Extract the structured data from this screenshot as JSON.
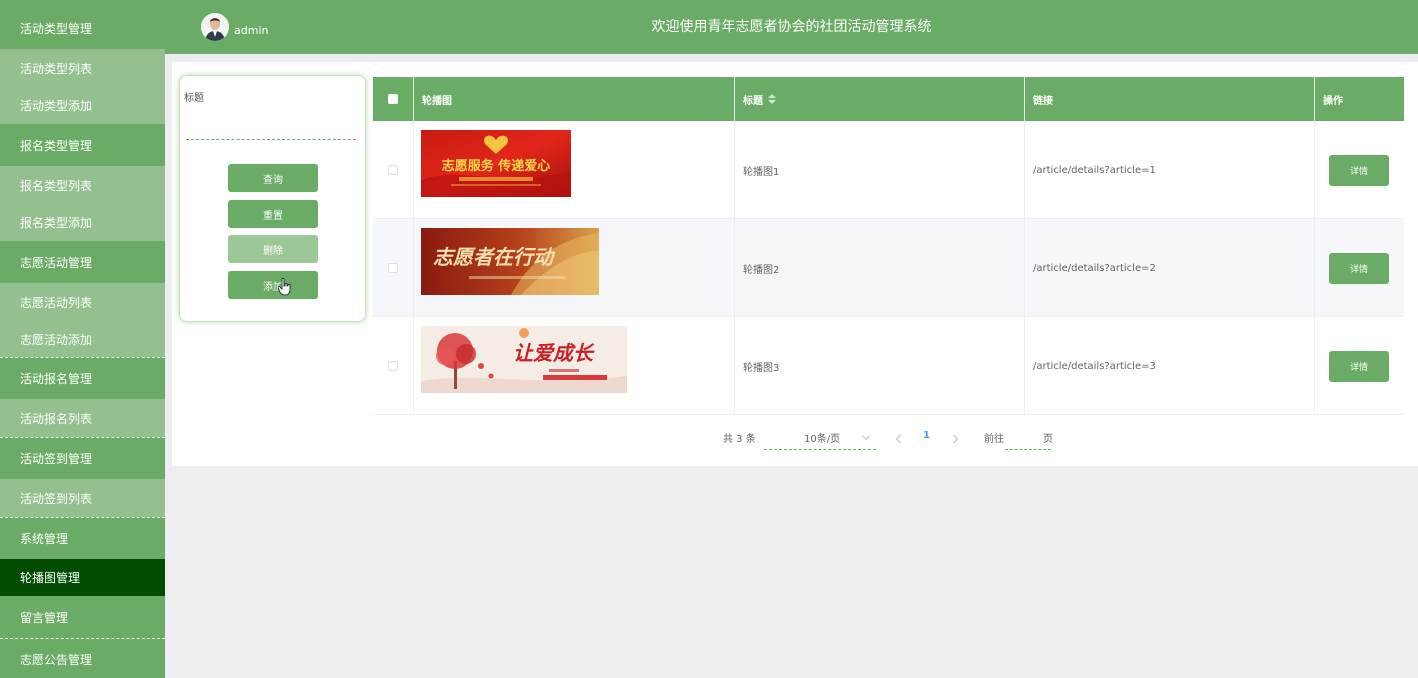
{
  "sidebar": {
    "items": [
      {
        "label": "活动类型管理",
        "kind": "group"
      },
      {
        "label": "活动类型列表",
        "kind": "sub"
      },
      {
        "label": "活动类型添加",
        "kind": "sub"
      },
      {
        "label": "报名类型管理",
        "kind": "group"
      },
      {
        "label": "报名类型列表",
        "kind": "sub"
      },
      {
        "label": "报名类型添加",
        "kind": "sub"
      },
      {
        "label": "志愿活动管理",
        "kind": "group"
      },
      {
        "label": "志愿活动列表",
        "kind": "sub"
      },
      {
        "label": "志愿活动添加",
        "kind": "sub"
      },
      {
        "label": "活动报名管理",
        "kind": "group"
      },
      {
        "label": "活动报名列表",
        "kind": "sub"
      },
      {
        "label": "活动签到管理",
        "kind": "group"
      },
      {
        "label": "活动签到列表",
        "kind": "sub"
      },
      {
        "label": "系统管理",
        "kind": "group"
      },
      {
        "label": "轮播图管理",
        "kind": "active"
      },
      {
        "label": "留言管理",
        "kind": "group"
      },
      {
        "label": "志愿公告管理",
        "kind": "group"
      }
    ]
  },
  "header": {
    "username": "admin",
    "title": "欢迎使用青年志愿者协会的社团活动管理系统"
  },
  "search": {
    "label": "标题",
    "value": "",
    "buttons": {
      "query": "查询",
      "reset": "重置",
      "delete": "删除",
      "add": "添加"
    }
  },
  "table": {
    "headers": {
      "image": "轮播图",
      "title": "标题",
      "link": "链接",
      "actions": "操作"
    },
    "rows": [
      {
        "title": "轮播图1",
        "link": "/article/details?article=1",
        "action": "详情",
        "banner_text": "志愿服务 传递爱心"
      },
      {
        "title": "轮播图2",
        "link": "/article/details?article=2",
        "action": "详情",
        "banner_text": "志愿者在行动"
      },
      {
        "title": "轮播图3",
        "link": "/article/details?article=3",
        "action": "详情",
        "banner_text": "让爱成长"
      }
    ]
  },
  "pagination": {
    "total": "共 3 条",
    "page_size": "10条/页",
    "current_page": "1",
    "goto_prefix": "前往",
    "goto_suffix": "页",
    "goto_value": ""
  },
  "colors": {
    "primary": "#6aab65",
    "sub_item": "#93c08e",
    "active_item": "#024d02",
    "page_bg": "#eeeef2"
  }
}
